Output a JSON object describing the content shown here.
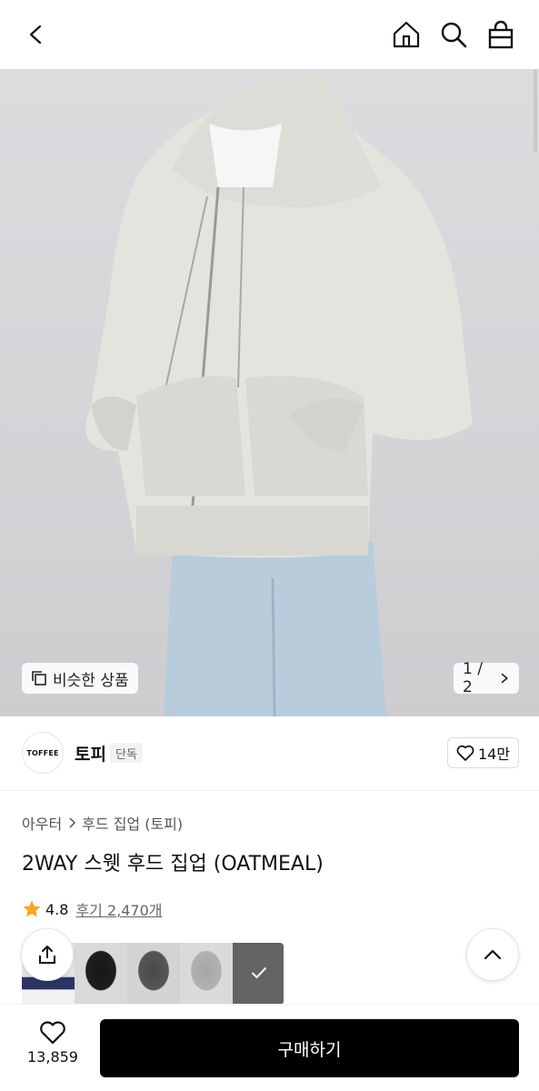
{
  "header": {
    "back_icon": "chevron-left-icon",
    "home_icon": "home-icon",
    "search_icon": "search-icon",
    "cart_icon": "shopping-bag-icon"
  },
  "hero": {
    "similar_label": "비슷한 상품",
    "pager": "1 / 2"
  },
  "brand": {
    "logo_text": "TOFFEE",
    "name": "토피",
    "tag": "단독",
    "likes": "14만"
  },
  "category": {
    "level1": "아우터",
    "level2": "후드 집업 (토피)"
  },
  "product": {
    "title": "2WAY 스웻 후드 집업 (OATMEAL)",
    "rating": "4.8",
    "reviews": "후기 2,470개"
  },
  "colors": {
    "accent_star": "#f5a623",
    "buy_button": "#000000"
  },
  "bottom": {
    "wish_count": "13,859",
    "buy_label": "구매하기"
  }
}
